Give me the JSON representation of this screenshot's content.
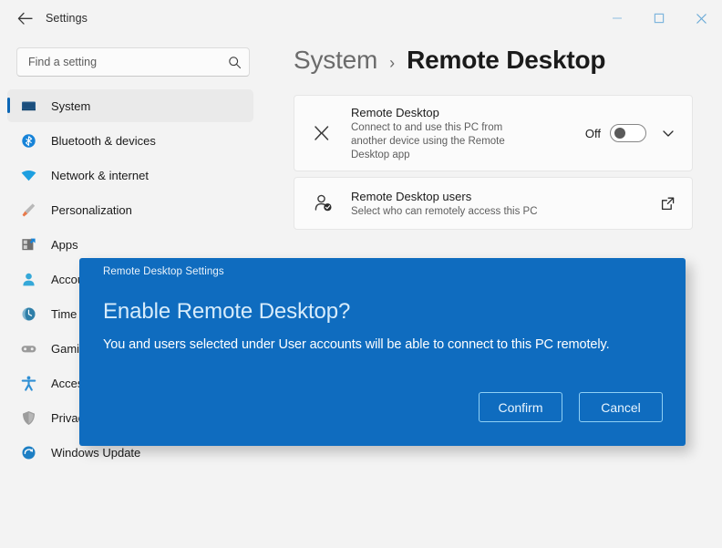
{
  "window": {
    "app_title": "Settings",
    "back_icon": "back-arrow-icon",
    "minimize_label": "Minimize",
    "maximize_label": "Maximize",
    "close_label": "Close"
  },
  "search": {
    "placeholder": "Find a setting",
    "icon": "search-icon"
  },
  "sidebar": {
    "items": [
      {
        "label": "System",
        "icon": "monitor-icon",
        "selected": true
      },
      {
        "label": "Bluetooth & devices",
        "icon": "bluetooth-icon",
        "selected": false
      },
      {
        "label": "Network & internet",
        "icon": "wifi-icon",
        "selected": false
      },
      {
        "label": "Personalization",
        "icon": "paintbrush-icon",
        "selected": false
      },
      {
        "label": "Apps",
        "icon": "apps-icon",
        "selected": false
      },
      {
        "label": "Accounts",
        "icon": "person-icon",
        "selected": false
      },
      {
        "label": "Time & language",
        "icon": "clock-globe-icon",
        "selected": false
      },
      {
        "label": "Gaming",
        "icon": "gamepad-icon",
        "selected": false
      },
      {
        "label": "Accessibility",
        "icon": "accessibility-icon",
        "selected": false
      },
      {
        "label": "Privacy & security",
        "icon": "shield-icon",
        "selected": false
      },
      {
        "label": "Windows Update",
        "icon": "update-icon",
        "selected": false
      }
    ]
  },
  "breadcrumb": {
    "root": "System",
    "separator": "›",
    "current": "Remote Desktop"
  },
  "main": {
    "cards": [
      {
        "icon": "remote-desktop-icon",
        "title": "Remote Desktop",
        "description": "Connect to and use this PC from another device using the Remote Desktop app",
        "toggle_label": "Off",
        "toggle_state": "off",
        "expand_icon": "chevron-down-icon"
      },
      {
        "icon": "user-check-icon",
        "title": "Remote Desktop users",
        "description": "Select who can remotely access this PC",
        "action_icon": "external-link-icon"
      }
    ]
  },
  "dialog": {
    "title": "Remote Desktop Settings",
    "heading": "Enable Remote Desktop?",
    "body": "You and users selected under User accounts will be able to connect to this PC remotely.",
    "confirm_label": "Confirm",
    "cancel_label": "Cancel",
    "accent_color": "#0f6cbf"
  }
}
